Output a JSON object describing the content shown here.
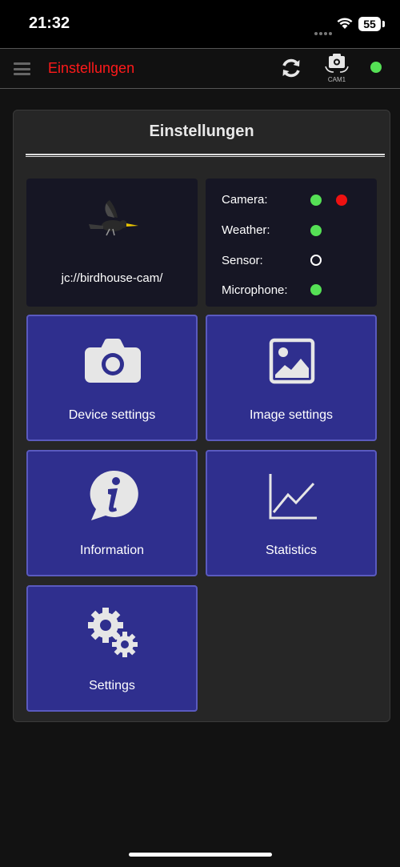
{
  "status_bar": {
    "time": "21:32",
    "battery": "55"
  },
  "header": {
    "title": "Einstellungen",
    "cam_label": "CAM1",
    "connection_color": "#55e055",
    "title_color": "#ff1a1a"
  },
  "panel": {
    "title": "Einstellungen"
  },
  "device": {
    "name": "jc://birdhouse-cam/"
  },
  "status": {
    "camera_label": "Camera:",
    "weather_label": "Weather:",
    "sensor_label": "Sensor:",
    "microphone_label": "Microphone:",
    "camera_states": [
      "green",
      "red"
    ],
    "weather_state": "green",
    "sensor_state": "empty",
    "microphone_state": "green"
  },
  "tiles": {
    "device_settings": "Device settings",
    "image_settings": "Image settings",
    "information": "Information",
    "statistics": "Statistics",
    "settings": "Settings"
  },
  "colors": {
    "tile_bg": "#2f2f8e",
    "tile_border": "#5a5abf",
    "status_green": "#55e055",
    "status_red": "#ee1111"
  }
}
